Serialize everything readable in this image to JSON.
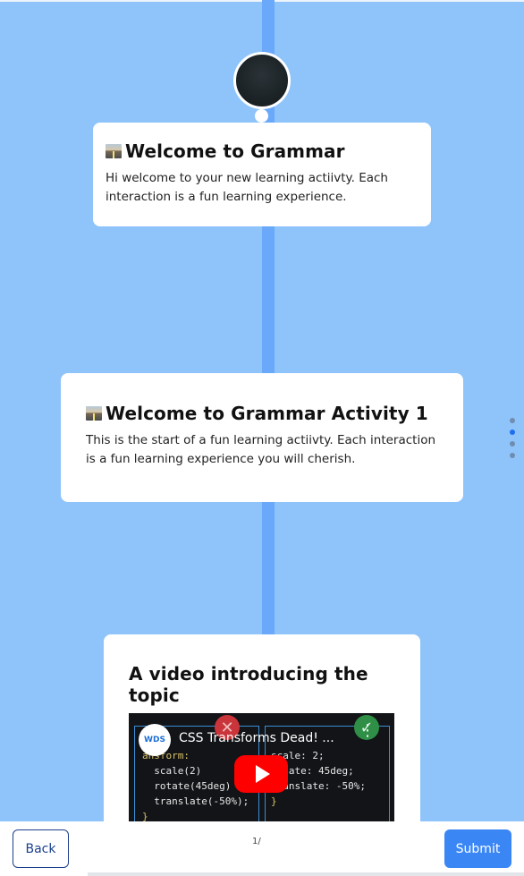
{
  "cards": [
    {
      "title": "Welcome to Grammar",
      "body": "Hi welcome to your new learning actiivty. Each interaction is a fun learning experience."
    },
    {
      "title": "Welcome to Grammar Activity 1",
      "body": "This is the start of a fun learning actiivty. Each interaction is a fun learning experience you will cherish."
    },
    {
      "title": "A video introducing the topic"
    }
  ],
  "video": {
    "channel_logo": "WDS",
    "title": "CSS Transforms Dead! ...",
    "code_left": [
      "ansform:",
      "  scale(2)",
      "  rotate(45deg)",
      "  translate(-50%);",
      "}"
    ],
    "code_right": [
      "scale: 2;",
      "rotate: 45deg;",
      "translate: -50%;",
      "}"
    ]
  },
  "icons": {
    "card_icon": "road-icon",
    "play": "play-icon",
    "menu": "more-vert-icon",
    "wrong": "x-icon",
    "right": "check-icon"
  },
  "footer": {
    "back_label": "Back",
    "submit_label": "Submit",
    "page_indicator": "1/"
  },
  "side_nav": {
    "count": 4,
    "active_index": 1
  },
  "colors": {
    "background": "#8fc4fb",
    "timeline": "#6aa9fa",
    "primary": "#3a86f5",
    "back_border": "#1a3f8c"
  }
}
